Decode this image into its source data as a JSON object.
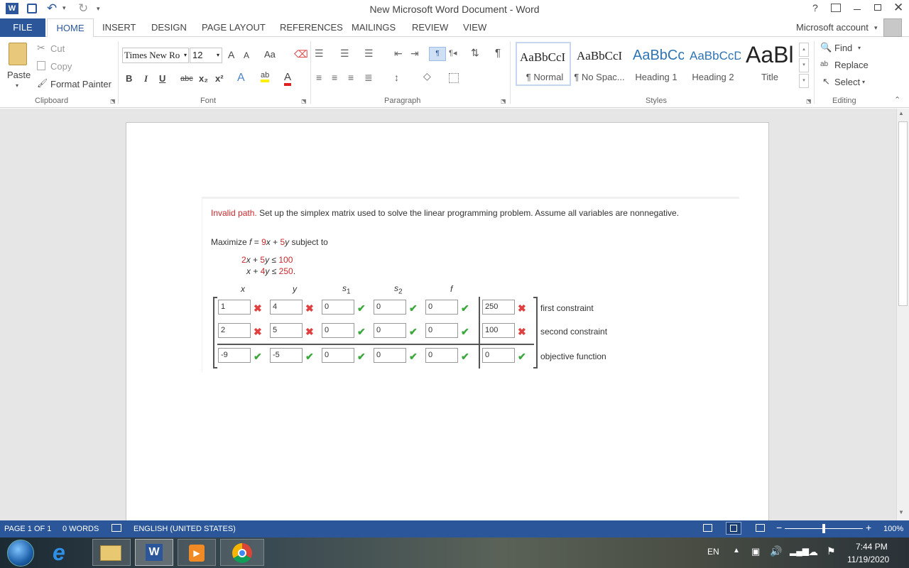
{
  "window": {
    "title": "New Microsoft Word Document - Word",
    "help": "?",
    "account": "Microsoft account"
  },
  "tabs": [
    "FILE",
    "HOME",
    "INSERT",
    "DESIGN",
    "PAGE LAYOUT",
    "REFERENCES",
    "MAILINGS",
    "REVIEW",
    "VIEW"
  ],
  "clipboard": {
    "paste": "Paste",
    "cut": "Cut",
    "copy": "Copy",
    "format_painter": "Format Painter",
    "label": "Clipboard"
  },
  "font": {
    "name": "Times New Ro",
    "size": "12",
    "label": "Font",
    "bold": "B",
    "italic": "I",
    "underline": "U",
    "strike": "abc",
    "sub": "x₂",
    "sup": "x²",
    "case": "Aa",
    "grow": "A",
    "shrink": "A",
    "color": "A",
    "highlight": "ab"
  },
  "paragraph": {
    "label": "Paragraph",
    "pilcrow": "¶",
    "ltr": "¶"
  },
  "styles": {
    "label": "Styles",
    "items": [
      {
        "preview": "AaBbCcI",
        "name": "¶ Normal"
      },
      {
        "preview": "AaBbCcI",
        "name": "¶ No Spac..."
      },
      {
        "preview": "AaBbCc",
        "name": "Heading 1"
      },
      {
        "preview": "AaBbCcD",
        "name": "Heading 2"
      },
      {
        "preview": "AaBl",
        "name": "Title"
      }
    ]
  },
  "editing": {
    "label": "Editing",
    "find": "Find",
    "replace": "Replace",
    "select": "Select"
  },
  "problem": {
    "invalid": "Invalid path.",
    "instruction": "Set up the simplex matrix used to solve the linear programming problem. Assume all variables are nonnegative.",
    "maximize_prefix": "Maximize",
    "f": "f",
    "eq": "=",
    "c1": "9",
    "x": "x",
    "plus": "+",
    "c2": "5",
    "y": "y",
    "subject": "subject to",
    "constraint1": {
      "a": "2",
      "b": "5",
      "rhs": "100",
      "end": ""
    },
    "constraint2": {
      "a": "",
      "b": "4",
      "rhs": "250",
      "end": "."
    },
    "le": "≤",
    "headers": [
      "x",
      "y",
      "s",
      "s",
      "f"
    ],
    "header_subs": [
      "",
      "",
      "1",
      "2",
      ""
    ],
    "rows": [
      {
        "values": [
          "1",
          "4",
          "0",
          "0",
          "0"
        ],
        "rhs": "250",
        "marks": [
          "x",
          "x",
          "ok",
          "ok",
          "ok"
        ],
        "rhs_mark": "x",
        "label": "first constraint"
      },
      {
        "values": [
          "2",
          "5",
          "0",
          "0",
          "0"
        ],
        "rhs": "100",
        "marks": [
          "x",
          "x",
          "ok",
          "ok",
          "ok"
        ],
        "rhs_mark": "x",
        "label": "second constraint"
      },
      {
        "values": [
          "-9",
          "-5",
          "0",
          "0",
          "0"
        ],
        "rhs": "0",
        "marks": [
          "ok",
          "ok",
          "ok",
          "ok",
          "ok"
        ],
        "rhs_mark": "ok",
        "label": "objective function"
      }
    ]
  },
  "status": {
    "page": "PAGE 1 OF 1",
    "words": "0 WORDS",
    "language": "ENGLISH (UNITED STATES)",
    "zoom": "100%",
    "zoom_level": 0.5
  },
  "taskbar": {
    "lang": "EN",
    "time": "7:44 PM",
    "date": "11/19/2020"
  }
}
